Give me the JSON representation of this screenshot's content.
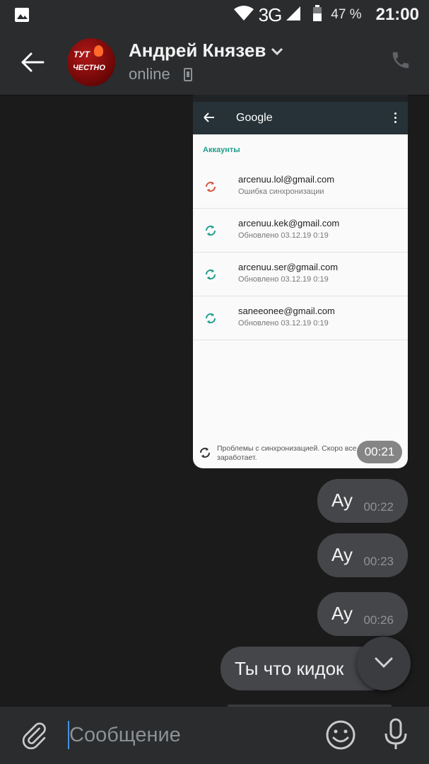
{
  "status_bar": {
    "network": "3G",
    "battery": "47 %",
    "time": "21:00"
  },
  "header": {
    "avatar_text_1": "ТУТ",
    "avatar_text_2": "ЧЕСТНО",
    "contact_name": "Андрей Князев",
    "status": "online"
  },
  "screenshot": {
    "app_title": "Google",
    "section_title": "Аккаунты",
    "accounts": [
      {
        "email": "arcenuu.lol@gmail.com",
        "status": "Ошибка синхронизации",
        "error": true
      },
      {
        "email": "arcenuu.kek@gmail.com",
        "status": "Обновлено 03.12.19 0:19",
        "error": false
      },
      {
        "email": "arcenuu.ser@gmail.com",
        "status": "Обновлено 03.12.19 0:19",
        "error": false
      },
      {
        "email": "saneeonee@gmail.com",
        "status": "Обновлено 03.12.19 0:19",
        "error": false
      }
    ],
    "footer_text": "Проблемы с синхронизацией. Скоро все заработает.",
    "time": "00:21"
  },
  "messages": [
    {
      "text": "Ау",
      "time": "00:22"
    },
    {
      "text": "Ау",
      "time": "00:23"
    },
    {
      "text": "Ау",
      "time": "00:26"
    },
    {
      "text": "Ты что кидок"
    }
  ],
  "composer": {
    "placeholder": "Сообщение"
  },
  "colors": {
    "background": "#1b1b1b",
    "bar": "#2a2c2e",
    "bubble": "#444649",
    "accent": "#1e9d8c",
    "error": "#d9533f"
  }
}
